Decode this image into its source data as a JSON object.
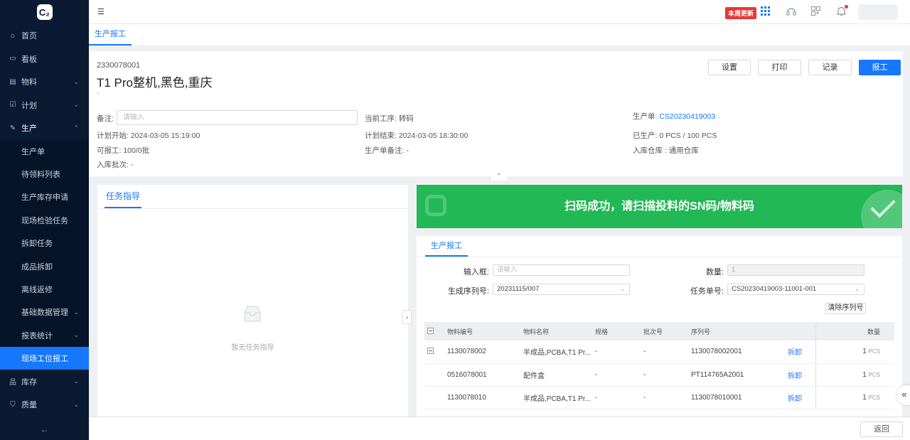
{
  "brand": {
    "logo_text": "C₂"
  },
  "sidebar": {
    "items": [
      {
        "label": "首页",
        "icon": "home-icon",
        "glyph": "⌂"
      },
      {
        "label": "看板",
        "icon": "board-icon",
        "glyph": "▭"
      },
      {
        "label": "物料",
        "icon": "box-icon",
        "glyph": "▤",
        "chevron": "⌄"
      },
      {
        "label": "计划",
        "icon": "check-square-icon",
        "glyph": "☑",
        "chevron": "⌄"
      },
      {
        "label": "生产",
        "icon": "wrench-icon",
        "glyph": "✎",
        "chevron": "⌃"
      }
    ],
    "sub_items": [
      {
        "label": "生产单"
      },
      {
        "label": "待领料列表"
      },
      {
        "label": "生产库存申请"
      },
      {
        "label": "现场检验任务"
      },
      {
        "label": "拆卸任务"
      },
      {
        "label": "成品拆卸"
      },
      {
        "label": "离线返修"
      },
      {
        "label": "基础数据管理",
        "chevron": "⌄"
      },
      {
        "label": "报表统计",
        "chevron": "⌄"
      },
      {
        "label": "现场工位报工"
      }
    ],
    "bottom_items": [
      {
        "label": "库存",
        "icon": "warehouse-icon",
        "glyph": "品",
        "chevron": "⌄"
      },
      {
        "label": "质量",
        "icon": "shield-icon",
        "glyph": "⛉",
        "chevron": "⌄"
      }
    ],
    "collapse_glyph": "←"
  },
  "topbar": {
    "menu_glyph": "☰",
    "update_badge": "本周更新"
  },
  "tabbar": {
    "active_tab": "生产报工"
  },
  "header": {
    "code": "2330078001",
    "title": "T1 Pro整机,黑色,重庆",
    "subtitle": "-",
    "buttons": {
      "settings": "设置",
      "print": "打印",
      "records": "记录",
      "report": "报工"
    },
    "remark_label": "备注:",
    "remark_placeholder": "请输入",
    "current_process_label": "当前工序:",
    "current_process": "转码",
    "order_label": "生产单:",
    "order_no": "CS20230419003",
    "plan_start_label": "计划开始:",
    "plan_start": "2024-03-05 15:19:00",
    "plan_end_label": "计划结束:",
    "plan_end": "2024-03-05 18:30:00",
    "produced_label": "已生产:",
    "produced": "0 PCS / 100 PCS",
    "reportable_label": "可报工:",
    "reportable": "100/0批",
    "order_remark_label": "生产单备注:",
    "order_remark": "-",
    "warehouse_label": "入库仓库 :",
    "warehouse": "通用仓库",
    "batch_label": "入库批次:",
    "batch": "-",
    "collapse_glyph": "⌃"
  },
  "task_panel": {
    "tab": "任务指导",
    "empty_text": "暂无任务指导",
    "collapse_glyph": "‹"
  },
  "banner": {
    "text": "扫码成功，请扫描投料的SN码/物料码",
    "color": "#22b855"
  },
  "report_panel": {
    "tab": "生产报工",
    "input_label": "输入框:",
    "input_placeholder": "请输入",
    "qty_label": "数量:",
    "qty_value": "1",
    "serial_label": "生成序列号:",
    "serial_value": "20231115/007",
    "task_label": "任务单号:",
    "task_value": "CS20230419003-11001-001",
    "clear_button": "清除序列号",
    "columns": [
      "物料编号",
      "物料名称",
      "规格",
      "批次号",
      "序列号",
      "",
      "数量"
    ],
    "rows": [
      {
        "code": "1130078002",
        "name": "半成品,PCBA,T1 Pr...",
        "spec": "-",
        "batch": "-",
        "serial": "1130078002001",
        "action": "拆卸",
        "qty": "1",
        "unit": "PCS"
      },
      {
        "code": "0516078001",
        "name": "配件盒",
        "spec": "-",
        "batch": "-",
        "serial": "PT114765A2001",
        "action": "拆卸",
        "qty": "1",
        "unit": "PCS"
      },
      {
        "code": "1130078010",
        "name": "半成品,PCBA,T1 Pr...",
        "spec": "-",
        "batch": "-",
        "serial": "1130078010001",
        "action": "拆卸",
        "qty": "1",
        "unit": "PCS"
      }
    ]
  },
  "right_float_glyph": "«",
  "bottom": {
    "back_button": "返回"
  },
  "colors": {
    "primary": "#1677ff",
    "sidebar_bg": "#0a1a33",
    "badge": "#e53935"
  }
}
